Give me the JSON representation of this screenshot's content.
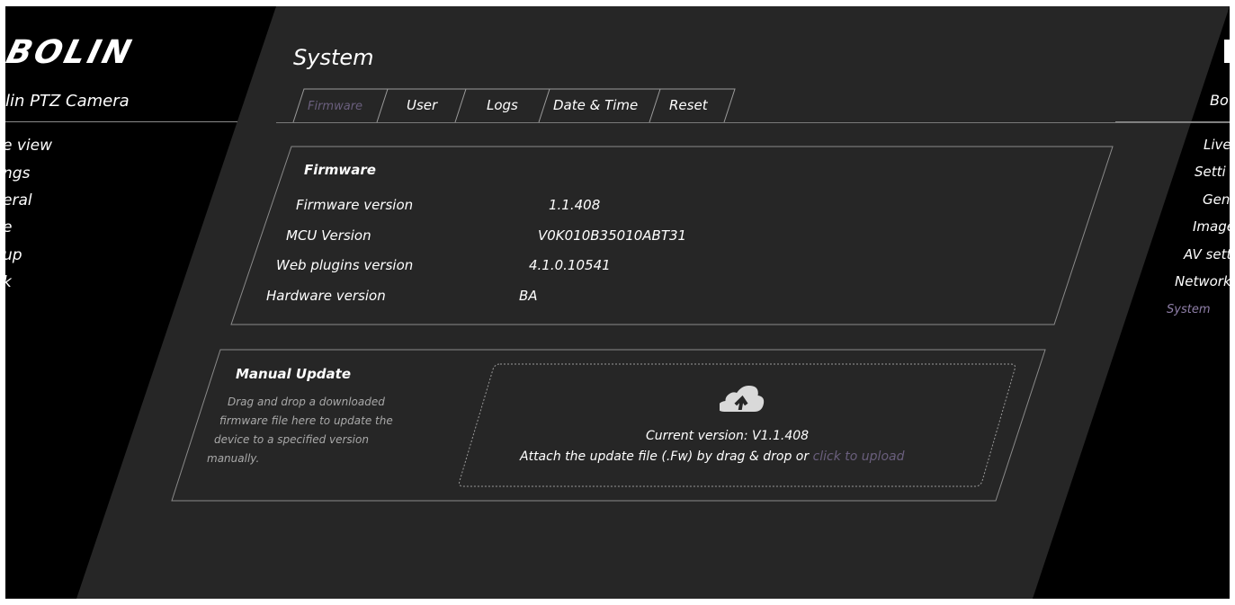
{
  "sidebar": {
    "logo": "BOLIN",
    "product": "lin PTZ Camera",
    "items": [
      {
        "label": "e view"
      },
      {
        "label": "ngs"
      },
      {
        "label": "eral"
      },
      {
        "label": "e"
      },
      {
        "label": "up"
      },
      {
        "label": "k"
      }
    ]
  },
  "right_sidebar": {
    "product": "Bo",
    "items": [
      {
        "label": "Live"
      },
      {
        "label": "Setti"
      },
      {
        "label": "Gen"
      },
      {
        "label": "Image"
      },
      {
        "label": "AV sett"
      },
      {
        "label": "Network"
      },
      {
        "label": "System"
      }
    ]
  },
  "page": {
    "title": "System"
  },
  "tabs": [
    {
      "label": "Firmware",
      "active": true
    },
    {
      "label": "User"
    },
    {
      "label": "Logs"
    },
    {
      "label": "Date & Time"
    },
    {
      "label": "Reset"
    }
  ],
  "firmware_section": {
    "title": "Firmware",
    "fields": [
      {
        "label": "Firmware version",
        "value": "1.1.408"
      },
      {
        "label": "MCU Version",
        "value": "V0K010B35010ABT31"
      },
      {
        "label": "Web plugins version",
        "value": "4.1.0.10541"
      },
      {
        "label": "Hardware version",
        "value": "BA"
      }
    ]
  },
  "manual_update": {
    "title": "Manual Update",
    "help_lines": [
      "Drag and drop a downloaded",
      "firmware file here to update the",
      "device to a specified version",
      "manually."
    ],
    "current_version": "Current version: V1.1.408",
    "attach_text": "Attach the update file (.Fw) by drag & drop or",
    "upload_link": "click to upload"
  },
  "colors": {
    "panel_bg": "#262626",
    "sidebar_bg": "#000000",
    "active_tab": "#6a5f7d",
    "border": "#9a9a9a"
  },
  "icons": {
    "upload": "cloud-upload-icon"
  }
}
